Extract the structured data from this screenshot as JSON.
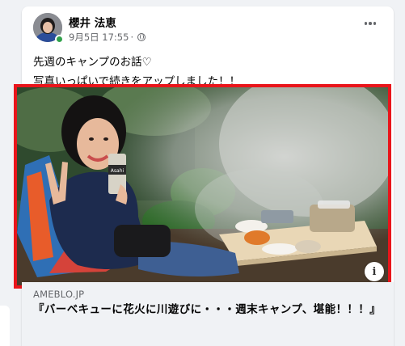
{
  "post": {
    "author": "櫻井 法恵",
    "date": "9月5日 17:55",
    "separator": "·",
    "privacy_icon": "globe-icon",
    "text_line1": "先週のキャンプのお話♡",
    "text_line2": "写真いっぱいで続きをアップしました！！"
  },
  "link": {
    "domain": "AMEBLO.JP",
    "title": "『バーベキューに花火に川遊びに・・・週末キャンプ、堪能！！！』"
  },
  "image": {
    "can_brand": "Asahi"
  },
  "colors": {
    "highlight_border": "#e9151b",
    "online": "#31a24c",
    "meta_text": "#65676b"
  }
}
